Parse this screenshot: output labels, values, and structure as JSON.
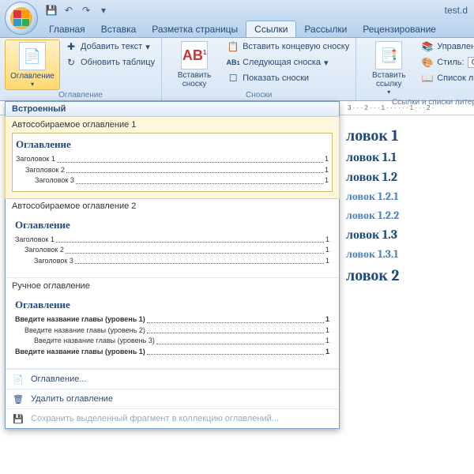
{
  "titlebar": {
    "filename": "test.d"
  },
  "tabs": {
    "items": [
      "Главная",
      "Вставка",
      "Разметка страницы",
      "Ссылки",
      "Рассылки",
      "Рецензирование"
    ],
    "active": 3
  },
  "ribbon": {
    "toc": {
      "label": "Оглавление",
      "add_text": "Добавить текст",
      "update": "Обновить таблицу",
      "group": "Оглавление"
    },
    "footnotes": {
      "insert": "Вставить сноску",
      "ab": "AB",
      "endnote": "Вставить концевую сноску",
      "next": "Следующая сноска",
      "show": "Показать сноски",
      "group": "Сноски"
    },
    "citations": {
      "insert": "Вставить ссылку",
      "manage": "Управление ис",
      "style": "Стиль:",
      "style_val": "Основн",
      "biblio": "Список литера",
      "group": "Ссылки и списки литер"
    }
  },
  "ruler": "3 · · · 2 · · · 1 · · · · · · 1 · · · 2 ·",
  "gallery": {
    "header": "Встроенный",
    "items": [
      {
        "name": "Автособираемое оглавление 1",
        "title": "Оглавление",
        "rows": [
          {
            "label": "Заголовок 1",
            "page": "1",
            "level": 1
          },
          {
            "label": "Заголовок 2",
            "page": "1",
            "level": 2
          },
          {
            "label": "Заголовок 3",
            "page": "1",
            "level": 3
          }
        ]
      },
      {
        "name": "Автособираемое оглавление 2",
        "title": "Оглавление",
        "rows": [
          {
            "label": "Заголовок 1",
            "page": "1",
            "level": 1
          },
          {
            "label": "Заголовок 2",
            "page": "1",
            "level": 2
          },
          {
            "label": "Заголовок 3",
            "page": "1",
            "level": 3
          }
        ]
      },
      {
        "name": "Ручное оглавление",
        "title": "Оглавление",
        "rows": [
          {
            "label": "Введите название главы (уровень 1)",
            "page": "1",
            "level": 1,
            "bold": true
          },
          {
            "label": "Введите название главы (уровень 2)",
            "page": "1",
            "level": 2
          },
          {
            "label": "Введите название главы (уровень 3)",
            "page": "1",
            "level": 3
          },
          {
            "label": "Введите название главы (уровень 1)",
            "page": "1",
            "level": 1,
            "bold": true
          }
        ]
      }
    ],
    "cmd_toc": "Оглавление...",
    "cmd_remove": "Удалить оглавление",
    "cmd_save": "Сохранить выделенный фрагмент в коллекцию оглавлений..."
  },
  "doc": {
    "headings": [
      {
        "text": "ловок 1",
        "cls": "h1"
      },
      {
        "text": "ловок 1.1",
        "cls": "h2"
      },
      {
        "text": "ловок 1.2",
        "cls": "h2"
      },
      {
        "text": "ловок 1.2.1",
        "cls": "h3"
      },
      {
        "text": "ловок 1.2.2",
        "cls": "h3"
      },
      {
        "text": "ловок 1.3",
        "cls": "h2"
      },
      {
        "text": "ловок 1.3.1",
        "cls": "h3"
      },
      {
        "text": "ловок 2",
        "cls": "h1"
      }
    ]
  }
}
